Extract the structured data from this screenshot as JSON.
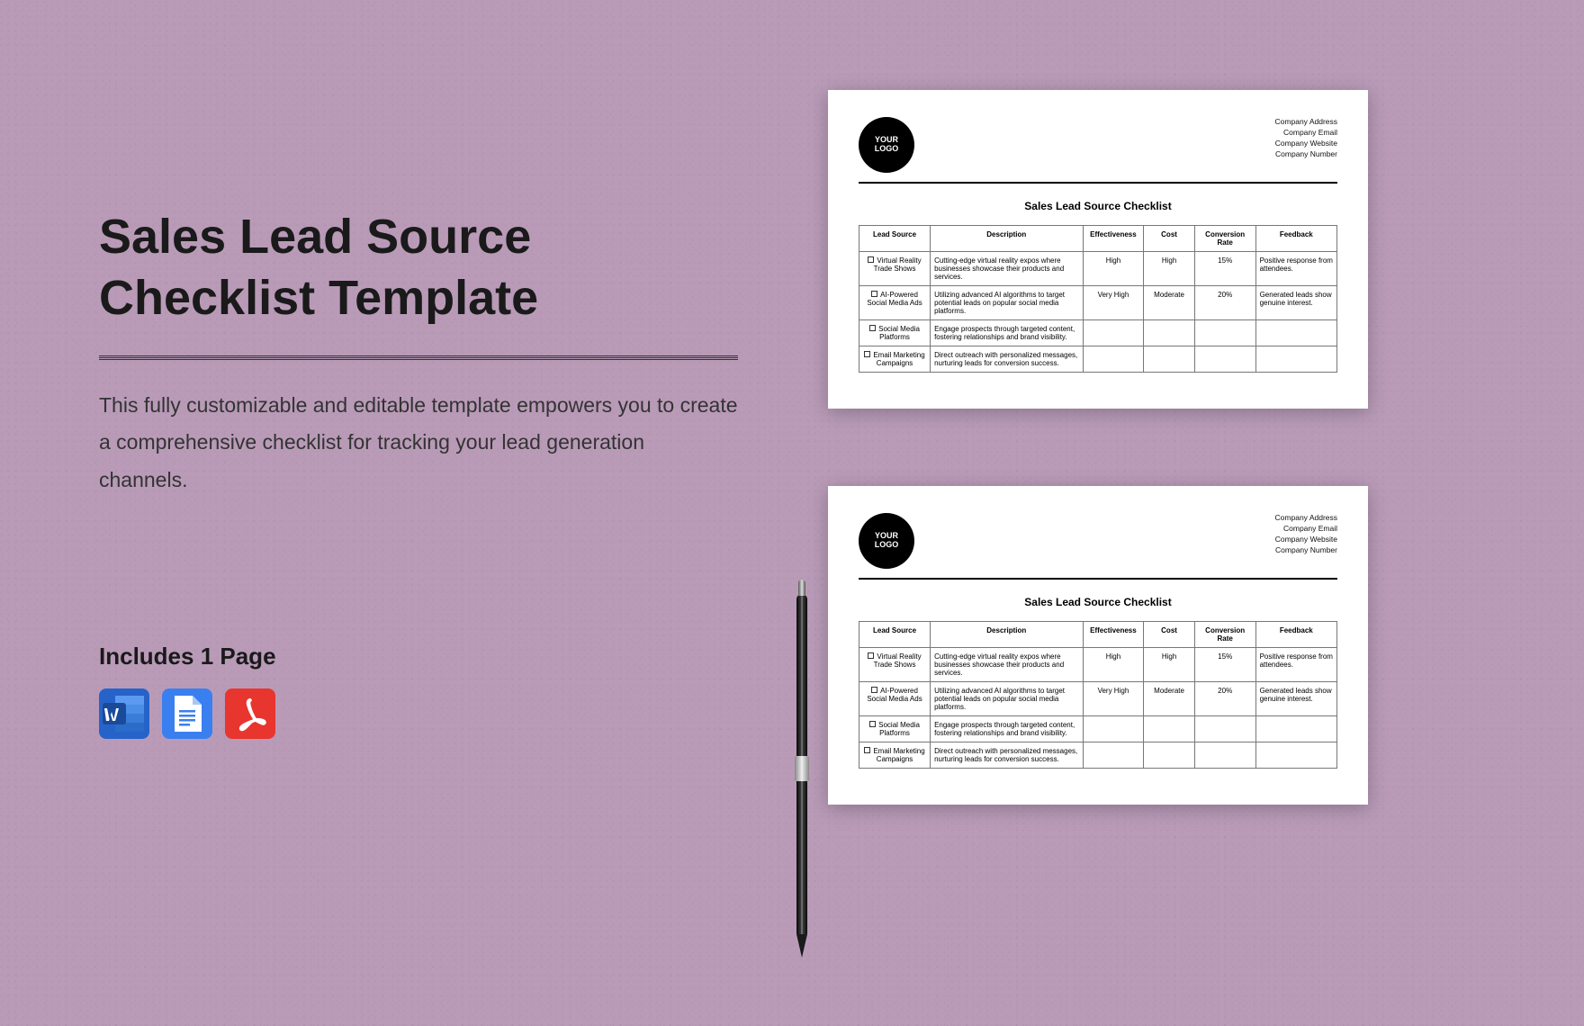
{
  "title": "Sales Lead Source Checklist Template",
  "description": "This fully customizable and editable template empowers you to create a comprehensive checklist for tracking your lead generation channels.",
  "includes_label": "Includes 1 Page",
  "icons": {
    "word": "word-icon",
    "gdocs": "gdocs-icon",
    "pdf": "pdf-icon"
  },
  "doc": {
    "logo_line1": "YOUR",
    "logo_line2": "LOGO",
    "company_lines": [
      "Company Address",
      "Company Email",
      "Company Website",
      "Company Number"
    ],
    "doc_title": "Sales Lead Source Checklist",
    "headers": [
      "Lead Source",
      "Description",
      "Effectiveness",
      "Cost",
      "Conversion Rate",
      "Feedback"
    ],
    "rows": [
      {
        "source": "Virtual Reality Trade Shows",
        "description": "Cutting-edge virtual reality expos where businesses showcase their products and services.",
        "effectiveness": "High",
        "cost": "High",
        "conversion": "15%",
        "feedback": "Positive response from attendees."
      },
      {
        "source": "AI-Powered Social Media Ads",
        "description": "Utilizing advanced AI algorithms to target potential leads on popular social media platforms.",
        "effectiveness": "Very High",
        "cost": "Moderate",
        "conversion": "20%",
        "feedback": "Generated leads show genuine interest."
      },
      {
        "source": "Social Media Platforms",
        "description": "Engage prospects through targeted content, fostering relationships and brand visibility.",
        "effectiveness": "",
        "cost": "",
        "conversion": "",
        "feedback": ""
      },
      {
        "source": "Email Marketing Campaigns",
        "description": "Direct outreach with personalized messages, nurturing leads for conversion success.",
        "effectiveness": "",
        "cost": "",
        "conversion": "",
        "feedback": ""
      }
    ]
  }
}
